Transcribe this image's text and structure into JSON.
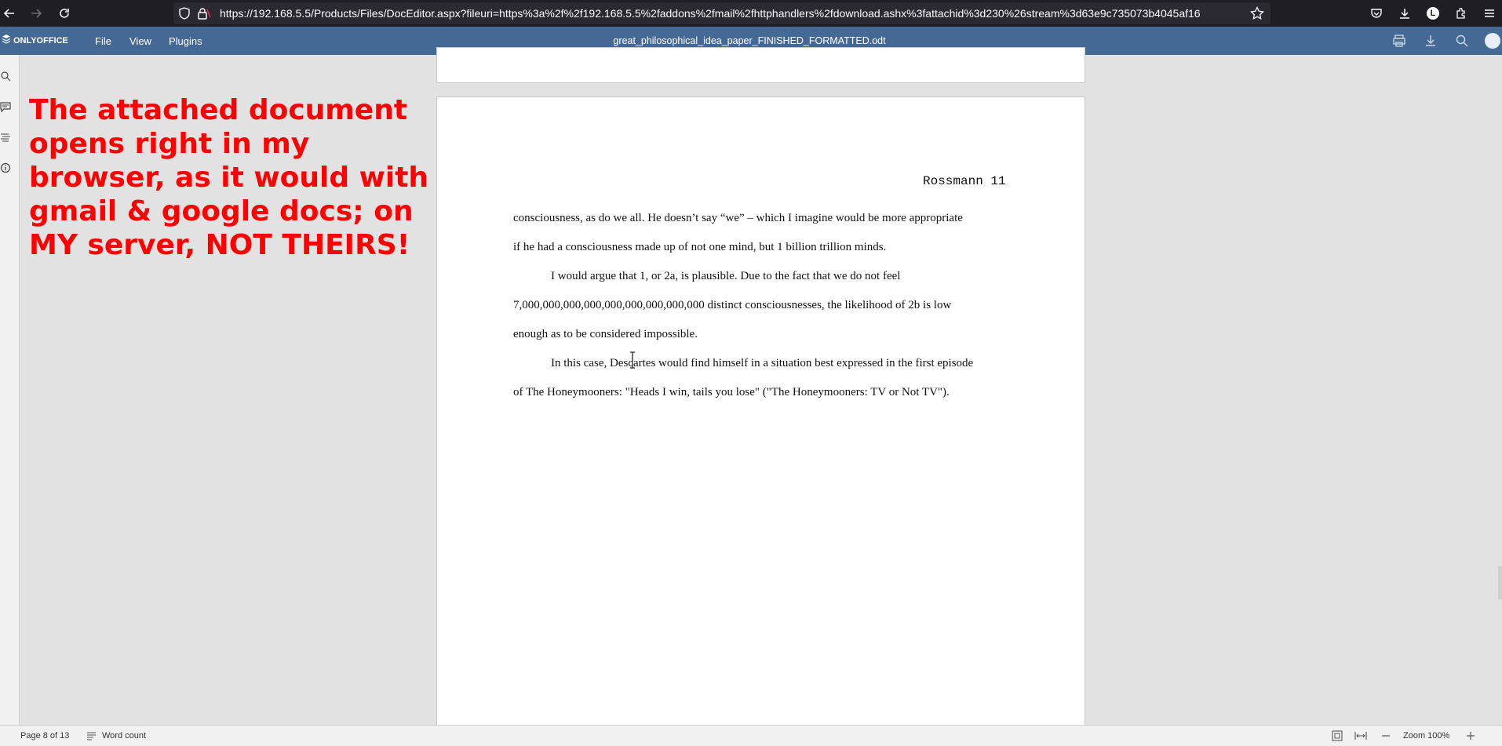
{
  "browser": {
    "url": "https://192.168.5.5/Products/Files/DocEditor.aspx?fileuri=https%3a%2f%2f192.168.5.5%2faddons%2fmail%2fhttphandlers%2fdownload.ashx%3fattachid%3d230%26stream%3d63e9c735073b4045af16"
  },
  "editor": {
    "brand": "ONLYOFFICE",
    "menu": [
      "File",
      "View",
      "Plugins"
    ],
    "doc_title": "great_philosophical_idea_paper_FINISHED_FORMATTED.odt"
  },
  "page": {
    "header_right": "Rossmann 11",
    "lines": [
      "consciousness, as do we all. He doesn’t say “we” – which I imagine would be more appropriate",
      "if he had a consciousness made up of not one mind, but 1 billion trillion minds.",
      "I would argue that 1, or 2a, is plausible. Due to the fact that we do not feel",
      "7,000,000,000,000,000,000,000,000,000 distinct consciousnesses, the likelihood of 2b is low",
      "enough as to be considered impossible.",
      "In this case, Descartes would find himself in a situation best expressed in the first episode",
      "of The Honeymooners: \"Heads I win, tails you lose\" (\"The Honeymooners: TV or Not TV\")."
    ]
  },
  "annotation": "The attached document opens right in my browser, as it would with gmail & google docs; on MY server, NOT THEIRS!",
  "status": {
    "page_info": "Page 8 of 13",
    "word_count": "Word count",
    "zoom": "Zoom 100%"
  },
  "colors": {
    "header": "#446995",
    "annotation": "#ff0000"
  }
}
